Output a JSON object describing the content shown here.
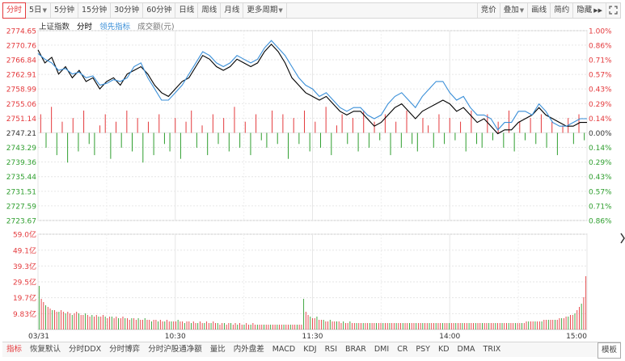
{
  "toolbar": {
    "periods": [
      {
        "label": "分时",
        "active": true,
        "dropdown": false
      },
      {
        "label": "5日",
        "active": false,
        "dropdown": true
      },
      {
        "label": "5分钟",
        "active": false,
        "dropdown": false
      },
      {
        "label": "15分钟",
        "active": false,
        "dropdown": false
      },
      {
        "label": "30分钟",
        "active": false,
        "dropdown": false
      },
      {
        "label": "60分钟",
        "active": false,
        "dropdown": false
      },
      {
        "label": "日线",
        "active": false,
        "dropdown": false
      },
      {
        "label": "周线",
        "active": false,
        "dropdown": false
      },
      {
        "label": "月线",
        "active": false,
        "dropdown": false
      },
      {
        "label": "更多周期",
        "active": false,
        "dropdown": true
      }
    ],
    "right": [
      {
        "label": "竞价",
        "dropdown": false
      },
      {
        "label": "叠加",
        "dropdown": true
      },
      {
        "label": "画线",
        "dropdown": false
      },
      {
        "label": "简约",
        "dropdown": false
      },
      {
        "label": "隐藏",
        "dropdown": false,
        "suffix": "▶▶"
      }
    ],
    "fullscreen_icon": "fullscreen-icon"
  },
  "legend": {
    "index_name": "上证指数",
    "mode": "分时",
    "lead_indicator": "领先指标",
    "volume": "成交额(元)"
  },
  "colors": {
    "up": "#e4393c",
    "down": "#2e9e2e",
    "price_line": "#000000",
    "lead_line": "#3a8fd8",
    "grid": "#e6e6e6",
    "axis_label": "#e4393c"
  },
  "chart_data": {
    "type": "line",
    "price_axis": {
      "left_ticks": [
        "2774.65",
        "2770.76",
        "2766.84",
        "2762.91",
        "2758.99",
        "2755.06",
        "2751.14",
        "2747.21",
        "2743.29",
        "2739.36",
        "2735.44",
        "2731.51",
        "2727.59",
        "2723.67"
      ],
      "right_ticks": [
        "1.00%",
        "0.86%",
        "0.71%",
        "0.57%",
        "0.43%",
        "0.29%",
        "0.14%",
        "0.00%",
        "0.14%",
        "0.29%",
        "0.43%",
        "0.57%",
        "0.71%",
        "0.86%"
      ],
      "ylim": [
        2723.67,
        2774.65
      ],
      "prev_close": 2747.21
    },
    "volume_axis": {
      "ticks": [
        "59.0亿",
        "49.1亿",
        "39.3亿",
        "29.5亿",
        "19.7亿",
        "9.83亿"
      ],
      "ylim": [
        0,
        59.0
      ]
    },
    "x_ticks": [
      "03/31",
      "10:30",
      "11:30",
      "14:00",
      "15:00"
    ],
    "x_range": [
      0,
      240
    ],
    "series": [
      {
        "key": "price",
        "points": [
          [
            0,
            2769.5
          ],
          [
            3,
            2766
          ],
          [
            6,
            2767.5
          ],
          [
            9,
            2763
          ],
          [
            12,
            2765
          ],
          [
            15,
            2762
          ],
          [
            18,
            2764
          ],
          [
            21,
            2761
          ],
          [
            24,
            2762
          ],
          [
            27,
            2759
          ],
          [
            30,
            2761
          ],
          [
            33,
            2762
          ],
          [
            36,
            2760
          ],
          [
            39,
            2763
          ],
          [
            42,
            2764
          ],
          [
            45,
            2765
          ],
          [
            48,
            2763
          ],
          [
            51,
            2760
          ],
          [
            54,
            2758
          ],
          [
            57,
            2757
          ],
          [
            60,
            2759
          ],
          [
            63,
            2761
          ],
          [
            66,
            2762
          ],
          [
            69,
            2765
          ],
          [
            72,
            2768
          ],
          [
            75,
            2767
          ],
          [
            78,
            2765
          ],
          [
            81,
            2764
          ],
          [
            84,
            2765
          ],
          [
            87,
            2767
          ],
          [
            90,
            2766
          ],
          [
            93,
            2765
          ],
          [
            96,
            2766
          ],
          [
            99,
            2769
          ],
          [
            102,
            2771
          ],
          [
            105,
            2769
          ],
          [
            108,
            2766
          ],
          [
            111,
            2762
          ],
          [
            114,
            2760
          ],
          [
            117,
            2758
          ],
          [
            120,
            2757
          ],
          [
            123,
            2756
          ],
          [
            126,
            2757
          ],
          [
            129,
            2755
          ],
          [
            132,
            2753
          ],
          [
            135,
            2752
          ],
          [
            138,
            2753
          ],
          [
            141,
            2753
          ],
          [
            144,
            2751
          ],
          [
            147,
            2749
          ],
          [
            150,
            2750
          ],
          [
            153,
            2752
          ],
          [
            156,
            2754
          ],
          [
            159,
            2755
          ],
          [
            162,
            2753
          ],
          [
            165,
            2751
          ],
          [
            168,
            2753
          ],
          [
            171,
            2754
          ],
          [
            174,
            2755
          ],
          [
            177,
            2756
          ],
          [
            180,
            2755
          ],
          [
            183,
            2753
          ],
          [
            186,
            2754
          ],
          [
            189,
            2752
          ],
          [
            192,
            2750
          ],
          [
            195,
            2751
          ],
          [
            198,
            2749
          ],
          [
            201,
            2747
          ],
          [
            204,
            2748
          ],
          [
            207,
            2748
          ],
          [
            210,
            2750
          ],
          [
            213,
            2751
          ],
          [
            216,
            2752
          ],
          [
            219,
            2754
          ],
          [
            222,
            2752
          ],
          [
            225,
            2751
          ],
          [
            228,
            2750
          ],
          [
            231,
            2749
          ],
          [
            234,
            2749
          ],
          [
            237,
            2750
          ],
          [
            240,
            2750
          ]
        ]
      },
      {
        "key": "lead",
        "points": [
          [
            0,
            2768.5
          ],
          [
            3,
            2767
          ],
          [
            6,
            2766
          ],
          [
            9,
            2764
          ],
          [
            12,
            2764.5
          ],
          [
            15,
            2763
          ],
          [
            18,
            2763.5
          ],
          [
            21,
            2762
          ],
          [
            24,
            2762.5
          ],
          [
            27,
            2760
          ],
          [
            30,
            2760.5
          ],
          [
            33,
            2761.5
          ],
          [
            36,
            2761
          ],
          [
            39,
            2762
          ],
          [
            42,
            2765
          ],
          [
            45,
            2766
          ],
          [
            48,
            2762
          ],
          [
            51,
            2759
          ],
          [
            54,
            2756
          ],
          [
            57,
            2756
          ],
          [
            60,
            2758
          ],
          [
            63,
            2760
          ],
          [
            66,
            2763
          ],
          [
            69,
            2766
          ],
          [
            72,
            2769
          ],
          [
            75,
            2768
          ],
          [
            78,
            2766
          ],
          [
            81,
            2765
          ],
          [
            84,
            2766
          ],
          [
            87,
            2768
          ],
          [
            90,
            2767
          ],
          [
            93,
            2766
          ],
          [
            96,
            2767
          ],
          [
            99,
            2770
          ],
          [
            102,
            2772
          ],
          [
            105,
            2770
          ],
          [
            108,
            2768
          ],
          [
            111,
            2765
          ],
          [
            114,
            2762
          ],
          [
            117,
            2760
          ],
          [
            120,
            2759
          ],
          [
            123,
            2757
          ],
          [
            126,
            2758
          ],
          [
            129,
            2756
          ],
          [
            132,
            2754
          ],
          [
            135,
            2753
          ],
          [
            138,
            2754
          ],
          [
            141,
            2754
          ],
          [
            144,
            2752
          ],
          [
            147,
            2751
          ],
          [
            150,
            2752
          ],
          [
            153,
            2755
          ],
          [
            156,
            2757
          ],
          [
            159,
            2758
          ],
          [
            162,
            2756
          ],
          [
            165,
            2754
          ],
          [
            168,
            2757
          ],
          [
            171,
            2759
          ],
          [
            174,
            2761
          ],
          [
            177,
            2761
          ],
          [
            180,
            2758
          ],
          [
            183,
            2756
          ],
          [
            186,
            2757
          ],
          [
            189,
            2754
          ],
          [
            192,
            2752
          ],
          [
            195,
            2752
          ],
          [
            198,
            2751
          ],
          [
            201,
            2748
          ],
          [
            204,
            2750
          ],
          [
            207,
            2750
          ],
          [
            210,
            2753
          ],
          [
            213,
            2753
          ],
          [
            216,
            2752
          ],
          [
            219,
            2755
          ],
          [
            222,
            2753
          ],
          [
            225,
            2750
          ],
          [
            228,
            2749
          ],
          [
            231,
            2749
          ],
          [
            234,
            2750
          ],
          [
            237,
            2751
          ],
          [
            240,
            2751
          ]
        ]
      }
    ],
    "lead_bars": [
      5,
      -4,
      7,
      -6,
      3,
      -8,
      4,
      -5,
      6,
      -3,
      -6,
      2,
      5,
      -7,
      3,
      -4,
      6,
      -5,
      4,
      -8,
      3,
      -6,
      5,
      -3,
      -5,
      4,
      -7,
      3,
      6,
      -4,
      2,
      -6,
      5,
      -3,
      4,
      -5,
      7,
      -4,
      3,
      -6,
      5,
      -2,
      -4,
      6,
      -3,
      5,
      -7,
      4,
      -3,
      6,
      -5,
      3,
      -4,
      7,
      -6,
      2,
      5,
      -3,
      4,
      -5,
      6,
      -4,
      3,
      -2,
      5,
      -6,
      3,
      -4,
      6,
      -3,
      -5,
      4,
      2,
      -4,
      5,
      -3,
      4,
      -2,
      3,
      -5,
      6,
      -3,
      -4,
      5,
      -2,
      3,
      -4,
      6,
      -5,
      3,
      -2,
      4,
      -3,
      5,
      -4,
      3,
      -6,
      2,
      4,
      -3,
      5,
      -2
    ],
    "volume": [
      27,
      19,
      17,
      15,
      14,
      13,
      12,
      12,
      11,
      11,
      12,
      11,
      10,
      11,
      10,
      9,
      10,
      11,
      10,
      9,
      9,
      10,
      9,
      8,
      9,
      8,
      9,
      8,
      8,
      9,
      8,
      7,
      8,
      8,
      7,
      8,
      7,
      7,
      8,
      7,
      7,
      6,
      7,
      7,
      6,
      7,
      6,
      6,
      7,
      6,
      6,
      5,
      6,
      6,
      5,
      6,
      5,
      5,
      6,
      5,
      5,
      5,
      5,
      6,
      5,
      5,
      4,
      5,
      5,
      4,
      5,
      4,
      4,
      5,
      4,
      4,
      5,
      4,
      4,
      5,
      4,
      4,
      3,
      4,
      4,
      3,
      4,
      4,
      3,
      4,
      3,
      4,
      3,
      3,
      4,
      3,
      3,
      4,
      3,
      3,
      3,
      3,
      3,
      3,
      3,
      3,
      3,
      3,
      3,
      3,
      3,
      3,
      3,
      3,
      3,
      3,
      3,
      3,
      3,
      3,
      19,
      11,
      9,
      8,
      7,
      7,
      8,
      6,
      6,
      6,
      5,
      5,
      6,
      5,
      5,
      5,
      5,
      4,
      5,
      4,
      4,
      5,
      4,
      4,
      4,
      4,
      4,
      4,
      4,
      4,
      4,
      4,
      4,
      4,
      4,
      4,
      4,
      4,
      4,
      4,
      4,
      4,
      4,
      4,
      4,
      4,
      4,
      4,
      4,
      4,
      4,
      4,
      4,
      4,
      4,
      4,
      4,
      4,
      4,
      4,
      4,
      4,
      4,
      4,
      4,
      4,
      4,
      4,
      4,
      4,
      4,
      4,
      4,
      4,
      4,
      4,
      4,
      4,
      4,
      4,
      4,
      4,
      4,
      4,
      4,
      4,
      4,
      4,
      4,
      4,
      4,
      4,
      4,
      4,
      4,
      4,
      4,
      4,
      4,
      4,
      4,
      5,
      5,
      5,
      5,
      5,
      5,
      5,
      5,
      6,
      6,
      6,
      6,
      6,
      6,
      6,
      7,
      7,
      7,
      8,
      8,
      9,
      9,
      10,
      12,
      14,
      16,
      20,
      33
    ]
  },
  "bottombar": {
    "items": [
      {
        "label": "指标",
        "active": true
      },
      {
        "label": "恢复默认",
        "active": false
      },
      {
        "label": "分时DDX",
        "active": false
      },
      {
        "label": "分时博弈",
        "active": false
      },
      {
        "label": "分时沪股通净额",
        "active": false
      },
      {
        "label": "量比",
        "active": false
      },
      {
        "label": "内外盘差",
        "active": false
      },
      {
        "label": "MACD",
        "active": false
      },
      {
        "label": "KDJ",
        "active": false
      },
      {
        "label": "RSI",
        "active": false
      },
      {
        "label": "BRAR",
        "active": false
      },
      {
        "label": "DMI",
        "active": false
      },
      {
        "label": "CR",
        "active": false
      },
      {
        "label": "PSY",
        "active": false
      },
      {
        "label": "KD",
        "active": false
      },
      {
        "label": "DMA",
        "active": false
      },
      {
        "label": "TRIX",
        "active": false
      }
    ],
    "template_button": "模板"
  }
}
